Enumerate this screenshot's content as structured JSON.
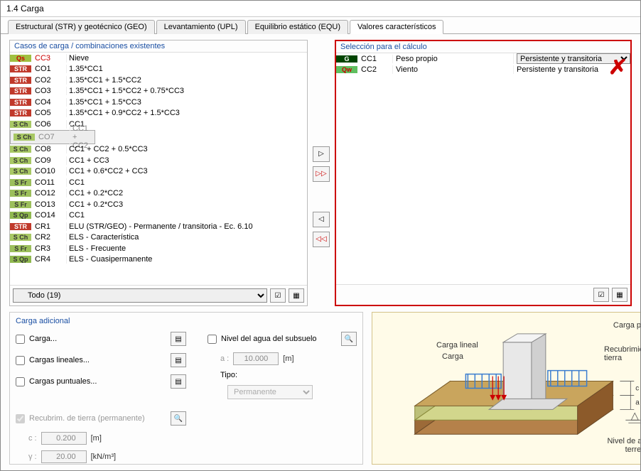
{
  "title": "1.4 Carga",
  "tabs": [
    {
      "label": "Estructural (STR) y geotécnico (GEO)"
    },
    {
      "label": "Levantamiento (UPL)"
    },
    {
      "label": "Equilibrio estático (EQU)"
    },
    {
      "label": "Valores característicos"
    }
  ],
  "left_panel_title": "Casos de carga / combinaciones existentes",
  "right_panel_title": "Selección para el cálculo",
  "left_rows": [
    {
      "tag": "Qs",
      "tagClass": "tag-qs",
      "code": "CC3",
      "codeRed": true,
      "desc": "Nieve"
    },
    {
      "tag": "STR",
      "tagClass": "tag-str",
      "code": "CO1",
      "desc": "1.35*CC1"
    },
    {
      "tag": "STR",
      "tagClass": "tag-str",
      "code": "CO2",
      "desc": "1.35*CC1 + 1.5*CC2"
    },
    {
      "tag": "STR",
      "tagClass": "tag-str",
      "code": "CO3",
      "desc": "1.35*CC1 + 1.5*CC2 + 0.75*CC3"
    },
    {
      "tag": "STR",
      "tagClass": "tag-str",
      "code": "CO4",
      "desc": "1.35*CC1 + 1.5*CC3"
    },
    {
      "tag": "STR",
      "tagClass": "tag-str",
      "code": "CO5",
      "desc": "1.35*CC1 + 0.9*CC2 + 1.5*CC3"
    },
    {
      "tag": "S Ch",
      "tagClass": "tag-sch",
      "code": "CO6",
      "desc": "CC1"
    },
    {
      "tag": "S Ch",
      "tagClass": "tag-sch",
      "code": "CO7",
      "desc": "CC1 + CC2",
      "sel": true
    },
    {
      "tag": "S Ch",
      "tagClass": "tag-sch",
      "code": "CO8",
      "desc": "CC1 + CC2 + 0.5*CC3"
    },
    {
      "tag": "S Ch",
      "tagClass": "tag-sch",
      "code": "CO9",
      "desc": "CC1 + CC3"
    },
    {
      "tag": "S Ch",
      "tagClass": "tag-sch",
      "code": "CO10",
      "desc": "CC1 + 0.6*CC2 + CC3"
    },
    {
      "tag": "S Fr",
      "tagClass": "tag-sfr",
      "code": "CO11",
      "desc": "CC1"
    },
    {
      "tag": "S Fr",
      "tagClass": "tag-sfr",
      "code": "CO12",
      "desc": "CC1 + 0.2*CC2"
    },
    {
      "tag": "S Fr",
      "tagClass": "tag-sfr",
      "code": "CO13",
      "desc": "CC1 + 0.2*CC3"
    },
    {
      "tag": "S Qp",
      "tagClass": "tag-sqp",
      "code": "CO14",
      "desc": "CC1"
    },
    {
      "tag": "STR",
      "tagClass": "tag-str",
      "code": "CR1",
      "desc": "ELU (STR/GEO) - Permanente / transitoria - Ec. 6.10"
    },
    {
      "tag": "S Ch",
      "tagClass": "tag-sch",
      "code": "CR2",
      "desc": "ELS - Característica"
    },
    {
      "tag": "S Fr",
      "tagClass": "tag-sfr",
      "code": "CR3",
      "desc": "ELS - Frecuente"
    },
    {
      "tag": "S Qp",
      "tagClass": "tag-sqp",
      "code": "CR4",
      "desc": "ELS - Cuasipermanente"
    }
  ],
  "right_rows": [
    {
      "tag": "G",
      "tagClass": "tag-g",
      "code": "CC1",
      "desc": "Peso propio",
      "dur": "Persistente y transitoria",
      "dd": true
    },
    {
      "tag": "Qw",
      "tagClass": "tag-qw",
      "code": "CC2",
      "desc": "Viento",
      "dur": "Persistente y transitoria"
    }
  ],
  "filter_label": "Todo (19)",
  "additional_load": {
    "title": "Carga adicional",
    "carga": "Carga...",
    "lineales": "Cargas lineales...",
    "puntuales": "Cargas puntuales...",
    "recubrim": "Recubrim. de tierra (permanente)",
    "c_label": "c :",
    "c_value": "0.200",
    "c_unit": "[m]",
    "g_label": "γ :",
    "g_value": "20.00",
    "g_unit": "[kN/m³]",
    "nivel": "Nivel del agua del subsuelo",
    "a_label": "a :",
    "a_value": "10.000",
    "a_unit": "[m]",
    "tipo_label": "Tipo:",
    "tipo_value": "Permanente"
  },
  "diagram": {
    "carga_puntual": "Carga puntual",
    "carga_lineal": "Carga lineal",
    "carga": "Carga",
    "recubrimiento": "Recubrimiento de tierra",
    "nivel_agua": "Nivel de agua del terreno"
  },
  "buttons": {
    "move_right": "▷",
    "move_all_right": "▷▷",
    "move_left": "◁",
    "move_all_left": "◁◁"
  }
}
